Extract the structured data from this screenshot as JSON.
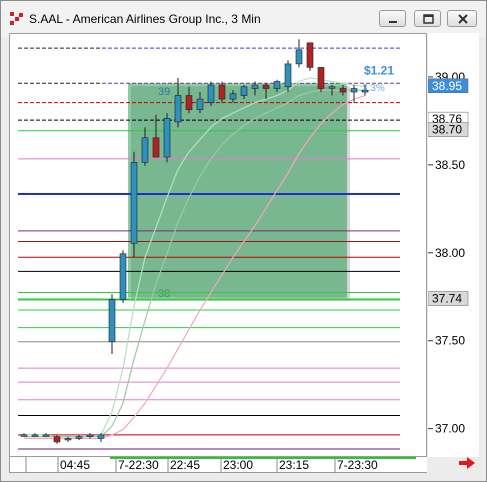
{
  "window": {
    "title": "S.AAL - American Airlines Group Inc., 3 Min",
    "buttons": [
      "minimize",
      "restore",
      "close"
    ]
  },
  "chart_data": {
    "type": "candlestick",
    "symbol": "S.AAL",
    "company": "American Airlines Group Inc.",
    "interval": "3 Min",
    "ylim": [
      36.85,
      39.25
    ],
    "y_tick_labels": [
      "39.00",
      "38.50",
      "38.00",
      "37.50",
      "37.00"
    ],
    "y_ticks": [
      39.0,
      38.5,
      38.0,
      37.5,
      37.0
    ],
    "x_tick_labels": [
      "04:45",
      "7-22:30",
      "22:45",
      "23:00",
      "23:15",
      "7-23:30"
    ],
    "price_labels": [
      {
        "text": "38.95",
        "value": 38.95,
        "bg": "#3c8dde",
        "fg": "#ffffff"
      },
      {
        "text": "38.76",
        "value": 38.76,
        "bg": "#ffffff",
        "fg": "#000000"
      },
      {
        "text": "38.70",
        "value": 38.7,
        "bg": "#d9d9d9",
        "fg": "#000000"
      },
      {
        "text": "37.74",
        "value": 37.74,
        "bg": "#d9d9d9",
        "fg": "#000000"
      }
    ],
    "horizontal_lines": [
      {
        "y": 39.17,
        "color": "#222222",
        "dash": true,
        "style": "left"
      },
      {
        "y": 39.17,
        "color": "#3b3bcc",
        "dash": true,
        "style": "right"
      },
      {
        "y": 38.97,
        "color": "#222222",
        "dash": true,
        "style": "left"
      },
      {
        "y": 38.97,
        "color": "#6a3aa3",
        "dash": true,
        "style": "right"
      },
      {
        "y": 38.86,
        "color": "#c00000",
        "dash": true,
        "style": "full"
      },
      {
        "y": 38.76,
        "color": "#000000",
        "dash": true,
        "style": "full"
      },
      {
        "y": 38.7,
        "color": "#2ecc40",
        "dash": false,
        "style": "full"
      },
      {
        "y": 38.54,
        "color": "#e07bd8",
        "dash": false,
        "style": "full"
      },
      {
        "y": 38.34,
        "color": "#1f2fd0",
        "dash": false,
        "style": "full",
        "width": 2
      },
      {
        "y": 38.13,
        "color": "#7a2a7a",
        "dash": false,
        "style": "full"
      },
      {
        "y": 38.07,
        "color": "#9a1a1a",
        "dash": false,
        "style": "full"
      },
      {
        "y": 37.98,
        "color": "#c00000",
        "dash": false,
        "style": "full"
      },
      {
        "y": 37.9,
        "color": "#000000",
        "dash": false,
        "style": "full"
      },
      {
        "y": 37.78,
        "color": "#2ecc40",
        "dash": false,
        "style": "full"
      },
      {
        "y": 37.74,
        "color": "#2ecc40",
        "dash": false,
        "style": "full",
        "width": 2
      },
      {
        "y": 37.68,
        "color": "#2ecc40",
        "dash": false,
        "style": "full"
      },
      {
        "y": 37.58,
        "color": "#2ecc40",
        "dash": false,
        "style": "full"
      },
      {
        "y": 37.5,
        "color": "#888888",
        "dash": false,
        "style": "full"
      },
      {
        "y": 37.35,
        "color": "#e07bd8",
        "dash": false,
        "style": "full"
      },
      {
        "y": 37.27,
        "color": "#e07bd8",
        "dash": false,
        "style": "full"
      },
      {
        "y": 37.17,
        "color": "#e07bd8",
        "dash": false,
        "style": "full"
      },
      {
        "y": 37.08,
        "color": "#000000",
        "dash": false,
        "style": "full"
      },
      {
        "y": 36.97,
        "color": "#c00000",
        "dash": false,
        "style": "full"
      },
      {
        "y": 36.89,
        "color": "#6a1a6a",
        "dash": false,
        "style": "full"
      }
    ],
    "range_box": {
      "top_price": 38.97,
      "bottom_price": 37.75,
      "top_label": "39",
      "bottom_label": "38",
      "color": "#2e9e5a"
    },
    "annotation": {
      "text": "$1.21",
      "subtext": "3.3%",
      "color": "#3c8dde"
    },
    "candles": [
      {
        "t": 0,
        "o": 36.97,
        "h": 36.98,
        "l": 36.96,
        "c": 36.97
      },
      {
        "t": 1,
        "o": 36.97,
        "h": 36.98,
        "l": 36.96,
        "c": 36.97
      },
      {
        "t": 2,
        "o": 36.97,
        "h": 36.98,
        "l": 36.96,
        "c": 36.97
      },
      {
        "t": 3,
        "o": 36.96,
        "h": 36.97,
        "l": 36.92,
        "c": 36.93
      },
      {
        "t": 4,
        "o": 36.95,
        "h": 36.96,
        "l": 36.93,
        "c": 36.95
      },
      {
        "t": 5,
        "o": 36.95,
        "h": 36.97,
        "l": 36.94,
        "c": 36.96
      },
      {
        "t": 6,
        "o": 36.96,
        "h": 36.98,
        "l": 36.95,
        "c": 36.97
      },
      {
        "t": 7,
        "o": 36.95,
        "h": 36.98,
        "l": 36.93,
        "c": 36.97
      },
      {
        "t": 8,
        "o": 37.5,
        "h": 37.77,
        "l": 37.43,
        "c": 37.74
      },
      {
        "t": 9,
        "o": 37.74,
        "h": 38.02,
        "l": 37.72,
        "c": 38.0
      },
      {
        "t": 10,
        "o": 38.06,
        "h": 38.58,
        "l": 37.98,
        "c": 38.52
      },
      {
        "t": 11,
        "o": 38.52,
        "h": 38.72,
        "l": 38.5,
        "c": 38.66
      },
      {
        "t": 12,
        "o": 38.66,
        "h": 38.79,
        "l": 38.55,
        "c": 38.55
      },
      {
        "t": 13,
        "o": 38.55,
        "h": 38.8,
        "l": 38.52,
        "c": 38.77
      },
      {
        "t": 14,
        "o": 38.75,
        "h": 39.0,
        "l": 38.72,
        "c": 38.9
      },
      {
        "t": 15,
        "o": 38.9,
        "h": 38.95,
        "l": 38.8,
        "c": 38.82
      },
      {
        "t": 16,
        "o": 38.82,
        "h": 38.92,
        "l": 38.8,
        "c": 38.88
      },
      {
        "t": 17,
        "o": 38.86,
        "h": 38.98,
        "l": 38.84,
        "c": 38.96
      },
      {
        "t": 18,
        "o": 38.96,
        "h": 38.98,
        "l": 38.86,
        "c": 38.88
      },
      {
        "t": 19,
        "o": 38.88,
        "h": 38.93,
        "l": 38.86,
        "c": 38.91
      },
      {
        "t": 20,
        "o": 38.9,
        "h": 38.96,
        "l": 38.88,
        "c": 38.95
      },
      {
        "t": 21,
        "o": 38.94,
        "h": 38.98,
        "l": 38.9,
        "c": 38.96
      },
      {
        "t": 22,
        "o": 38.96,
        "h": 38.97,
        "l": 38.88,
        "c": 38.94
      },
      {
        "t": 23,
        "o": 38.94,
        "h": 38.99,
        "l": 38.92,
        "c": 38.98
      },
      {
        "t": 24,
        "o": 38.95,
        "h": 39.1,
        "l": 38.92,
        "c": 39.08
      },
      {
        "t": 25,
        "o": 39.08,
        "h": 39.22,
        "l": 39.06,
        "c": 39.16
      },
      {
        "t": 26,
        "o": 39.2,
        "h": 39.2,
        "l": 39.04,
        "c": 39.06
      },
      {
        "t": 27,
        "o": 39.06,
        "h": 39.06,
        "l": 38.92,
        "c": 38.94
      },
      {
        "t": 28,
        "o": 38.95,
        "h": 38.96,
        "l": 38.9,
        "c": 38.95
      },
      {
        "t": 29,
        "o": 38.94,
        "h": 38.96,
        "l": 38.9,
        "c": 38.92
      },
      {
        "t": 30,
        "o": 38.92,
        "h": 38.96,
        "l": 38.86,
        "c": 38.94
      },
      {
        "t": 31,
        "o": 38.92,
        "h": 38.96,
        "l": 38.9,
        "c": 38.93
      }
    ],
    "bull_color": "#2f8fbd",
    "bear_color": "#b22222",
    "moving_averages": [
      {
        "color": "#b8e0c0",
        "values": [
          36.97,
          36.97,
          36.97,
          36.96,
          36.96,
          36.96,
          36.96,
          36.97,
          37.1,
          37.35,
          37.7,
          37.98,
          38.15,
          38.32,
          38.48,
          38.58,
          38.65,
          38.72,
          38.77,
          38.8,
          38.83,
          38.86,
          38.88,
          38.9,
          38.93,
          38.98,
          39.0,
          38.99,
          38.98,
          38.97,
          38.96,
          38.95
        ]
      },
      {
        "color": "#9cc9a6",
        "values": [
          36.96,
          36.96,
          36.96,
          36.96,
          36.96,
          36.96,
          36.96,
          36.96,
          37.02,
          37.15,
          37.4,
          37.62,
          37.83,
          38.0,
          38.18,
          38.32,
          38.44,
          38.54,
          38.62,
          38.68,
          38.73,
          38.77,
          38.8,
          38.83,
          38.86,
          38.9,
          38.92,
          38.93,
          38.93,
          38.93,
          38.93,
          38.93
        ]
      },
      {
        "color": "#f2a6c2",
        "values": [
          36.95,
          36.95,
          36.95,
          36.95,
          36.95,
          36.95,
          36.95,
          36.95,
          36.97,
          37.0,
          37.07,
          37.15,
          37.25,
          37.35,
          37.46,
          37.57,
          37.68,
          37.78,
          37.88,
          37.98,
          38.07,
          38.16,
          38.26,
          38.36,
          38.46,
          38.57,
          38.66,
          38.74,
          38.8,
          38.85,
          38.88,
          38.9
        ]
      }
    ]
  }
}
